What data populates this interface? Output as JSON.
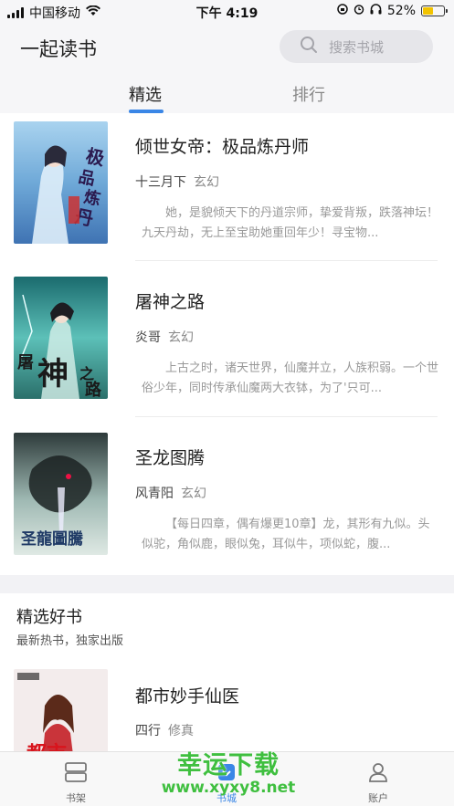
{
  "status_bar": {
    "carrier": "中国移动",
    "time": "下午 4:19",
    "battery_percent": "52%",
    "battery_level": 0.52
  },
  "header": {
    "app_title": "一起读书",
    "search_placeholder": "搜索书城",
    "tabs": [
      {
        "label": "精选",
        "active": true
      },
      {
        "label": "排行",
        "active": false
      }
    ]
  },
  "featured_books": [
    {
      "title": "倾世女帝：极品炼丹师",
      "author": "十三月下",
      "genre": "玄幻",
      "description": "她，是貌倾天下的丹道宗师，挚爱背叛，跌落神坛！九天丹劫，无上至宝助她重回年少！寻宝物..."
    },
    {
      "title": "屠神之路",
      "author": "炎哥",
      "genre": "玄幻",
      "description": "上古之时，诸天世界，仙魔并立，人族积弱。一个世俗少年，同时传承仙魔两大衣钵，为了'只可..."
    },
    {
      "title": "圣龙图腾",
      "author": "风青阳",
      "genre": "玄幻",
      "description": "【每日四章，偶有爆更10章】龙，其形有九似。头似驼，角似鹿，眼似兔，耳似牛，项似蛇，腹..."
    }
  ],
  "selected_section": {
    "title": "精选好书",
    "subtitle": "最新热书，独家出版",
    "books": [
      {
        "title": "都市妙手仙医",
        "author": "四行",
        "genre": "修真"
      }
    ]
  },
  "tab_bar": [
    {
      "label": "书架",
      "icon": "bookshelf-icon",
      "active": false
    },
    {
      "label": "书城",
      "icon": "bookstore-icon",
      "active": true
    },
    {
      "label": "账户",
      "icon": "account-icon",
      "active": false
    }
  ],
  "watermark": {
    "text": "幸运下载",
    "url": "www.xyxy8.net"
  },
  "colors": {
    "accent": "#3a86e6",
    "watermark": "#3fbf3f"
  }
}
